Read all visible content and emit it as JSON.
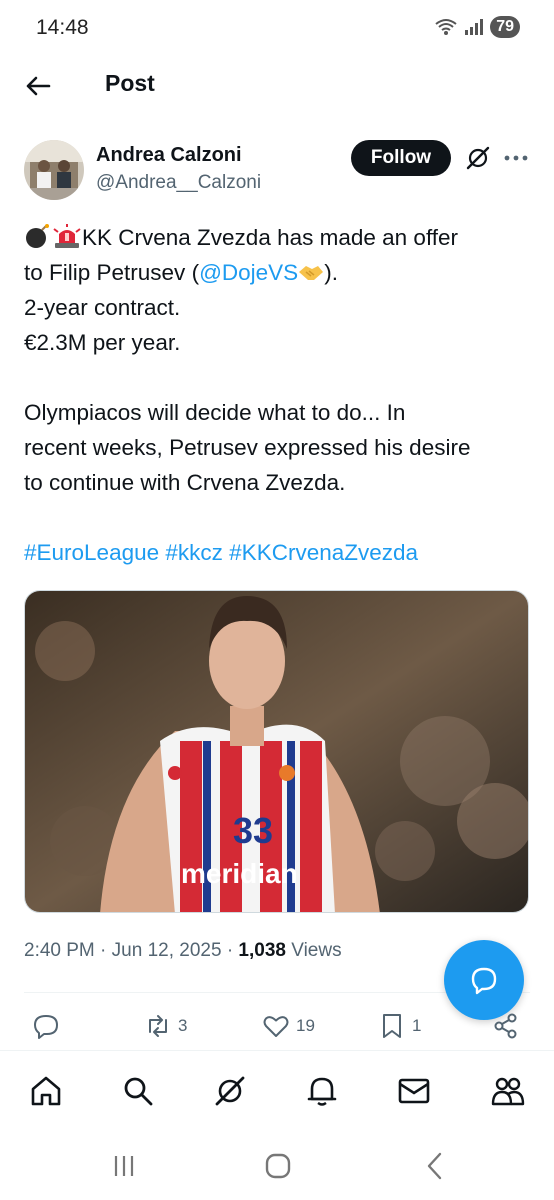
{
  "status_bar": {
    "time": "14:48",
    "battery": "79"
  },
  "header": {
    "title": "Post"
  },
  "author": {
    "name": "Andrea Calzoni",
    "handle": "@Andrea__Calzoni"
  },
  "follow_label": "Follow",
  "tweet": {
    "line1_text": "KK Crvena Zvezda has made an offer",
    "line2_before": "to Filip Petrusev (",
    "line2_mention": "@DojeVS",
    "line2_after": ").",
    "line3": "2-year contract.",
    "line4": "€2.3M per year.",
    "para2_line1": "Olympiacos will decide what to do... In",
    "para2_line2": "recent weeks, Petrusev expressed his desire",
    "para2_line3": "to continue with Crvena Zvezda.",
    "hashtags": [
      "#EuroLeague",
      "#kkcz",
      "#KKCrvenaZvezda"
    ]
  },
  "media": {
    "jersey_number": "33",
    "sponsor_text": "meridian"
  },
  "meta": {
    "time": "2:40 PM",
    "date": "Jun 12, 2025",
    "views_count": "1,038",
    "views_label": "Views"
  },
  "actions": {
    "reply_count": "",
    "retweet_count": "3",
    "like_count": "19",
    "bookmark_count": "1"
  },
  "colors": {
    "accent": "#1d9bf0",
    "text": "#0f1419",
    "muted": "#536471"
  },
  "icons": {
    "back": "arrow-left-icon",
    "grok": "grok-icon",
    "more": "more-icon",
    "reply": "reply-icon",
    "retweet": "retweet-icon",
    "like": "heart-icon",
    "bookmark": "bookmark-icon",
    "share": "share-icon",
    "compose": "compose-reply-icon",
    "nav": [
      "home-icon",
      "search-icon",
      "grok-icon",
      "notifications-icon",
      "messages-icon",
      "communities-icon"
    ]
  }
}
